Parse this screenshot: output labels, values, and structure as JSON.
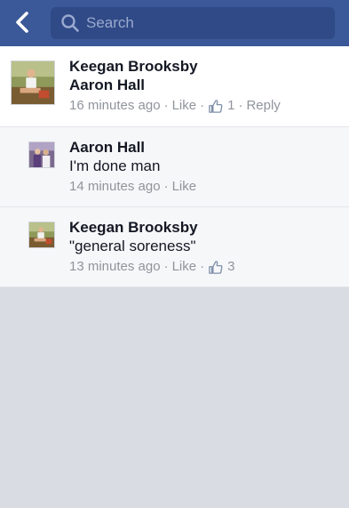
{
  "search": {
    "placeholder": "Search",
    "value": ""
  },
  "colors": {
    "nav_bar": "#3b5998",
    "search_field": "#2f4a86",
    "page_background": "#d9dce2",
    "meta_text": "#90949c"
  },
  "icons": {
    "back": "chevron-left-icon",
    "search": "search-icon",
    "like": "thumbs-up-icon"
  },
  "comments": [
    {
      "author": "Keegan Brooksby",
      "text": "Aaron Hall",
      "time": "16 minutes ago",
      "like_label": "Like",
      "like_count": "1",
      "reply_label": "Reply"
    },
    {
      "author": "Aaron Hall",
      "text": "I'm done man",
      "time": "14 minutes ago",
      "like_label": "Like"
    },
    {
      "author": "Keegan Brooksby",
      "text": "\"general soreness\"",
      "time": "13 minutes ago",
      "like_label": "Like",
      "like_count": "3"
    }
  ],
  "separator": "·"
}
